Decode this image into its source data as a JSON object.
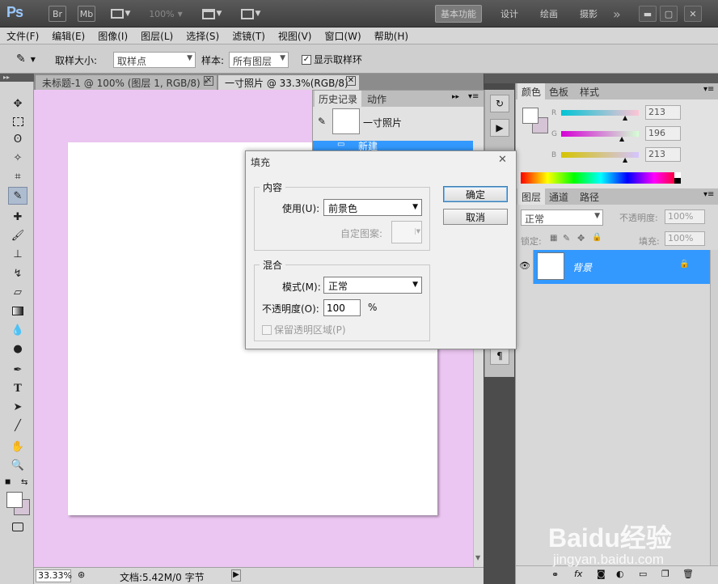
{
  "app": {
    "logo": "Ps",
    "bridge_label": "Br",
    "minibridge_label": "Mb",
    "zoom_dropdown": "100%",
    "workspaces": [
      "基本功能",
      "设计",
      "绘画",
      "摄影"
    ],
    "more": "»"
  },
  "menu": [
    "文件(F)",
    "编辑(E)",
    "图像(I)",
    "图层(L)",
    "选择(S)",
    "滤镜(T)",
    "视图(V)",
    "窗口(W)",
    "帮助(H)"
  ],
  "options": {
    "sample_size_label": "取样大小:",
    "sample_size_value": "取样点",
    "sample_label": "样本:",
    "sample_value": "所有图层",
    "show_ring_label": "显示取样环"
  },
  "tabs": [
    {
      "label": "未标题-1 @ 100% (图层 1, RGB/8) *"
    },
    {
      "label": "一寸照片 @ 33.3%(RGB/8)"
    }
  ],
  "history": {
    "tab_history": "历史记录",
    "tab_actions": "动作",
    "snapshot_name": "一寸照片",
    "items": [
      "新建"
    ]
  },
  "color": {
    "tabs": [
      "颜色",
      "色板",
      "样式"
    ],
    "channels": [
      {
        "label": "R",
        "value": "213"
      },
      {
        "label": "G",
        "value": "196"
      },
      {
        "label": "B",
        "value": "213"
      }
    ],
    "foreground": "#ffffff",
    "background": "#d5c4d5"
  },
  "layers": {
    "tabs": [
      "图层",
      "通道",
      "路径"
    ],
    "blend_mode": "正常",
    "opacity_label": "不透明度:",
    "opacity_value": "100%",
    "lock_label": "锁定:",
    "fill_label": "填充:",
    "fill_value": "100%",
    "items": [
      {
        "name": "背景"
      }
    ]
  },
  "status": {
    "zoom": "33.33%",
    "doc_info": "文档:5.42M/0 字节"
  },
  "dialog": {
    "title": "填充",
    "content_legend": "内容",
    "use_label": "使用(U):",
    "use_value": "前景色",
    "custom_pattern_label": "自定图案:",
    "blend_legend": "混合",
    "mode_label": "模式(M):",
    "mode_value": "正常",
    "opacity_label": "不透明度(O):",
    "opacity_value": "100",
    "opacity_unit": "%",
    "preserve_label": "保留透明区域(P)",
    "ok_label": "确定",
    "cancel_label": "取消"
  },
  "watermark": {
    "brand": "Baidu经验",
    "url": "jingyan.baidu.com"
  },
  "colors": {
    "doc_bg": "#ecc6f2",
    "selection": "#3399ff",
    "panel": "#e2e2e2"
  }
}
